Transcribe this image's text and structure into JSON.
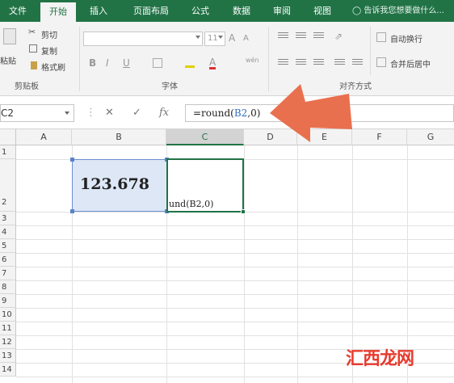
{
  "ribbon_tabs": [
    "文件",
    "开始",
    "插入",
    "页面布局",
    "公式",
    "数据",
    "审阅",
    "视图"
  ],
  "active_tab": "开始",
  "tell_me": "告诉我您想要做什么...",
  "clipboard": {
    "paste": "粘贴",
    "cut": "剪切",
    "copy": "复制",
    "format_painter": "格式刷",
    "group_label": "剪贴板"
  },
  "font": {
    "name_value": "",
    "size_value": "11",
    "bold": "B",
    "italic": "I",
    "underline": "U",
    "group_label": "字体",
    "phonetic": "wén",
    "grow": "A",
    "shrink": "A"
  },
  "alignment": {
    "wrap_text": "自动换行",
    "merge_center": "合并后居中",
    "group_label": "对齐方式"
  },
  "formula_bar": {
    "name_box": "C2",
    "cancel": "✕",
    "enter": "✓",
    "fx": "fx",
    "formula_prefix": "=round(",
    "formula_ref": "B2",
    "formula_suffix": ",0)"
  },
  "columns": [
    "A",
    "B",
    "C",
    "D",
    "E",
    "F",
    "G"
  ],
  "selected_column": "C",
  "rows": [
    "1",
    "2",
    "3",
    "4",
    "5",
    "6",
    "7",
    "8",
    "9",
    "10",
    "11",
    "12",
    "13",
    "14"
  ],
  "cells": {
    "B2": "123.678",
    "C2": "und(B2,0)"
  },
  "watermark": "汇西龙网",
  "colors": {
    "excel_green": "#217346",
    "selection_blue": "#dde7f6",
    "arrow": "#e9704f"
  }
}
